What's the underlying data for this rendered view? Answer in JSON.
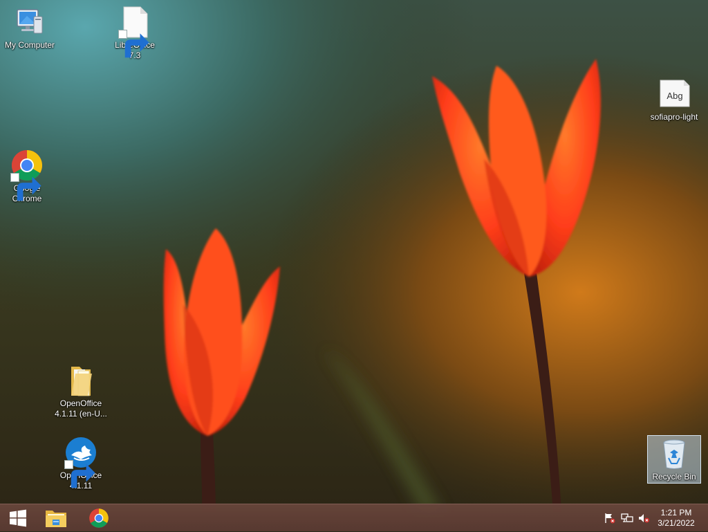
{
  "desktop": {
    "icons": {
      "my_computer": {
        "label": "My Computer",
        "icon": "computer-icon"
      },
      "libreoffice": {
        "label": "LibreOffice\n7.3",
        "icon": "libreoffice-file-icon"
      },
      "sofiapro": {
        "label": "sofiapro-light",
        "icon": "font-file-icon",
        "glyph_text": "Abg"
      },
      "chrome": {
        "label": "Google\nChrome",
        "icon": "chrome-icon"
      },
      "oo_folder": {
        "label": "OpenOffice\n4.1.11 (en-U...",
        "icon": "folder-icon"
      },
      "oo_app": {
        "label": "OpenOffice\n4.1.11",
        "icon": "openoffice-icon"
      },
      "recycle_bin": {
        "label": "Recycle Bin",
        "icon": "recycle-bin-icon"
      }
    }
  },
  "taskbar": {
    "start_icon": "windows-logo-icon",
    "pinned": [
      "file-explorer-icon",
      "chrome-icon"
    ],
    "tray": [
      "action-center-flag-icon",
      "network-icon",
      "volume-muted-icon"
    ],
    "clock": {
      "time": "1:21 PM",
      "date": "3/21/2022"
    }
  },
  "colors": {
    "accent_taskbar": "#5e3d33",
    "tulip": "#ff4a1c",
    "chrome_red": "#db4437",
    "chrome_yellow": "#f4c20d",
    "chrome_green": "#0f9d58",
    "chrome_blue": "#4285f4"
  }
}
